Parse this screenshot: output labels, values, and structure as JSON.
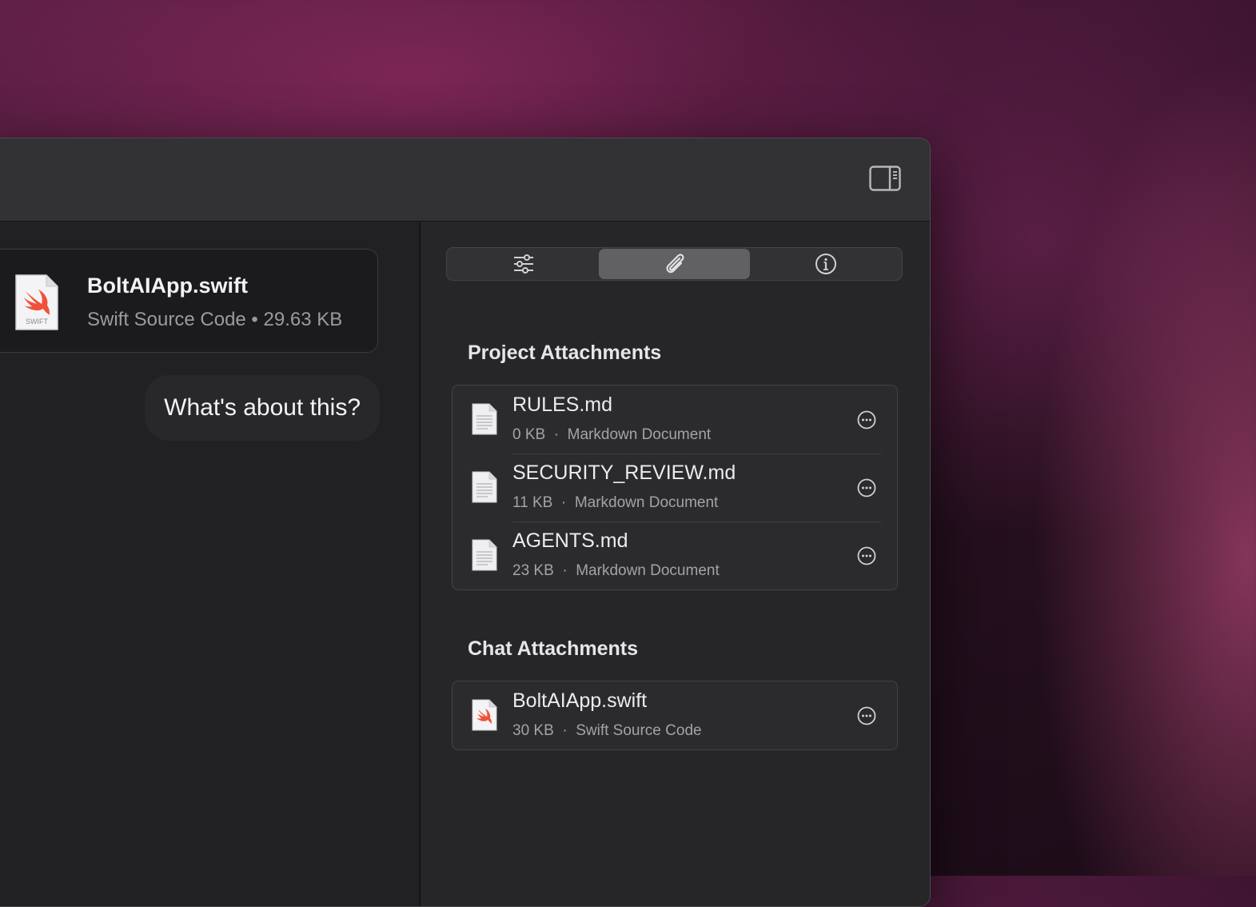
{
  "chat": {
    "attachment_card": {
      "file_name": "BoltAIApp.swift",
      "file_meta": "Swift Source Code • 29.63 KB",
      "icon_label": "SWIFT"
    },
    "user_message": "What's about this?"
  },
  "inspector": {
    "tabs": [
      {
        "name": "settings",
        "icon": "sliders-icon",
        "active": false
      },
      {
        "name": "attachments",
        "icon": "paperclip-icon",
        "active": true
      },
      {
        "name": "info",
        "icon": "info-icon",
        "active": false
      }
    ],
    "project_section": {
      "title": "Project Attachments",
      "items": [
        {
          "name": "RULES.md",
          "size": "0 KB",
          "type": "Markdown Document"
        },
        {
          "name": "SECURITY_REVIEW.md",
          "size": "11 KB",
          "type": "Markdown Document"
        },
        {
          "name": "AGENTS.md",
          "size": "23 KB",
          "type": "Markdown Document"
        }
      ]
    },
    "chat_section": {
      "title": "Chat Attachments",
      "items": [
        {
          "name": "BoltAIApp.swift",
          "size": "30 KB",
          "type": "Swift Source Code"
        }
      ]
    }
  },
  "colors": {
    "swift_orange": "#f05138",
    "active_tab": "#616164",
    "window_bg": "#232325"
  }
}
